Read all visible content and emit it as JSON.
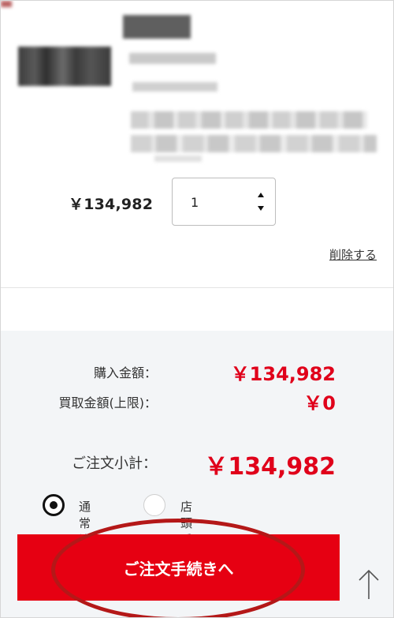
{
  "cart_item": {
    "unit_price": "￥134,982",
    "quantity": "1",
    "delete_label": "削除する"
  },
  "summary": {
    "purchase_label": "購入金額：",
    "purchase_value": "￥134,982",
    "buyback_label": "買取金額(上限)：",
    "buyback_value": "￥0",
    "subtotal_label": "ご注文小計：",
    "subtotal_value": "￥134,982"
  },
  "order_type": {
    "options": [
      {
        "label": "通常注文",
        "selected": true
      },
      {
        "label": "店頭受取注文",
        "selected": false
      }
    ]
  },
  "actions": {
    "checkout_label": "ご注文手続きへ"
  },
  "colors": {
    "accent_red": "#e60012",
    "price_red": "#e0001a",
    "summary_bg": "#f3f5f7"
  },
  "icons": {
    "scroll_top": "up-arrow-icon",
    "spinner": "spinner-icon"
  }
}
